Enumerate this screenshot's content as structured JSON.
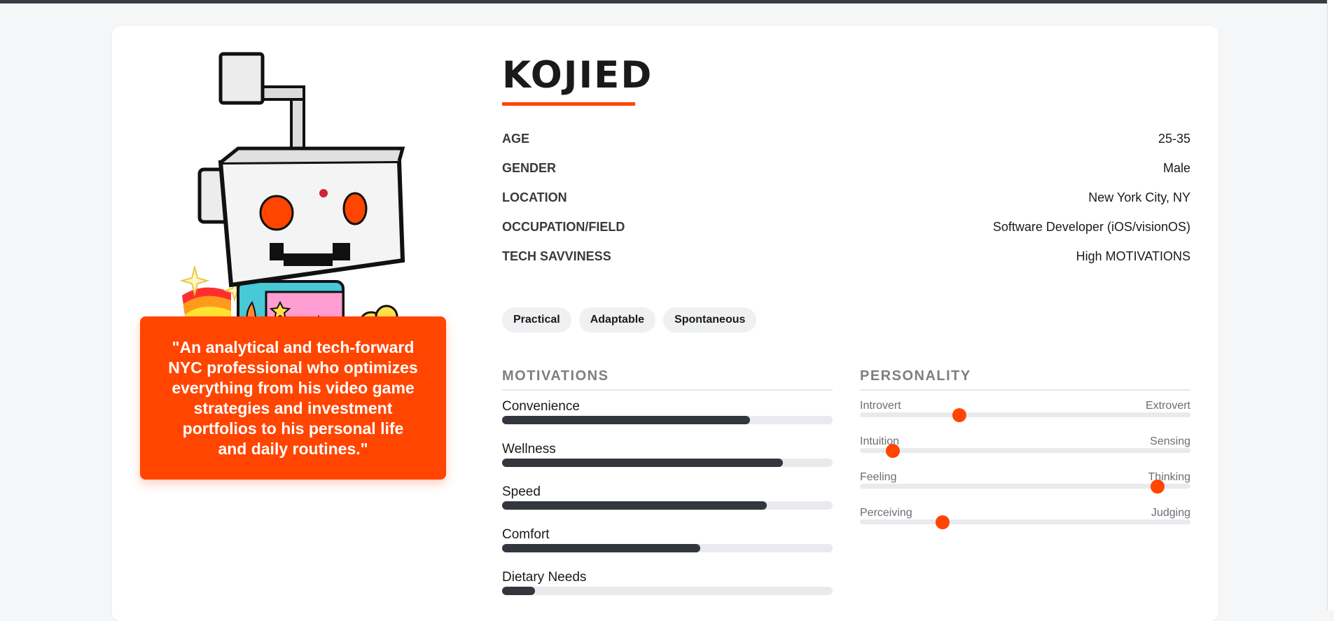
{
  "colors": {
    "accent": "#ff4500",
    "bar": "#33363c",
    "track": "#e8eaed"
  },
  "persona": {
    "name": "KOJIED",
    "quote": "\"An analytical and tech-forward NYC professional who optimizes everything from his video game strategies and investment portfolios to his personal life and daily routines.\"",
    "avatar_icon": "reddit-snoo-robot-avatar"
  },
  "info": [
    {
      "label": "AGE",
      "value": "25-35"
    },
    {
      "label": "GENDER",
      "value": "Male"
    },
    {
      "label": "LOCATION",
      "value": "New York City, NY"
    },
    {
      "label": "OCCUPATION/FIELD",
      "value": "Software Developer (iOS/visionOS)"
    },
    {
      "label": "TECH SAVVINESS",
      "value": "High MOTIVATIONS"
    }
  ],
  "tags": [
    "Practical",
    "Adaptable",
    "Spontaneous"
  ],
  "motivations": {
    "title": "MOTIVATIONS",
    "items": [
      {
        "label": "Convenience",
        "value": 0.75
      },
      {
        "label": "Wellness",
        "value": 0.85
      },
      {
        "label": "Speed",
        "value": 0.8
      },
      {
        "label": "Comfort",
        "value": 0.6
      },
      {
        "label": "Dietary Needs",
        "value": 0.1
      }
    ]
  },
  "personality": {
    "title": "PERSONALITY",
    "items": [
      {
        "left": "Introvert",
        "right": "Extrovert",
        "value": 0.3
      },
      {
        "left": "Intuition",
        "right": "Sensing",
        "value": 0.1
      },
      {
        "left": "Feeling",
        "right": "Thinking",
        "value": 0.9
      },
      {
        "left": "Perceiving",
        "right": "Judging",
        "value": 0.25
      }
    ]
  }
}
